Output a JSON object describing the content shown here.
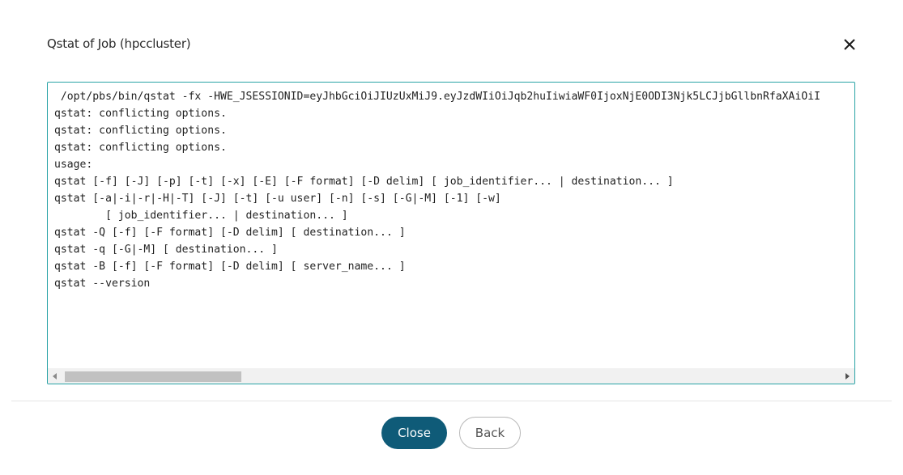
{
  "dialog": {
    "title": "Qstat of Job (hpccluster)",
    "close_icon": "close-icon"
  },
  "output": {
    "lines": [
      " /opt/pbs/bin/qstat -fx -HWE_JSESSIONID=eyJhbGciOiJIUzUxMiJ9.eyJzdWIiOiJqb2huIiwiaWF0IjoxNjE0ODI3Njk5LCJjbGllbnRfaXAiOiI",
      "qstat: conflicting options.",
      "qstat: conflicting options.",
      "qstat: conflicting options.",
      "usage:",
      "qstat [-f] [-J] [-p] [-t] [-x] [-E] [-F format] [-D delim] [ job_identifier... | destination... ]",
      "qstat [-a|-i|-r|-H|-T] [-J] [-t] [-u user] [-n] [-s] [-G|-M] [-1] [-w]",
      "        [ job_identifier... | destination... ]",
      "qstat -Q [-f] [-F format] [-D delim] [ destination... ]",
      "qstat -q [-G|-M] [ destination... ]",
      "qstat -B [-f] [-F format] [-D delim] [ server_name... ]",
      "qstat --version"
    ],
    "scrollbar": {
      "left_arrow_icon": "arrow-left-icon",
      "right_arrow_icon": "arrow-right-icon"
    }
  },
  "footer": {
    "close_label": "Close",
    "back_label": "Back"
  },
  "colors": {
    "primary_button": "#0f5b78",
    "output_border": "#2aa3a6"
  }
}
